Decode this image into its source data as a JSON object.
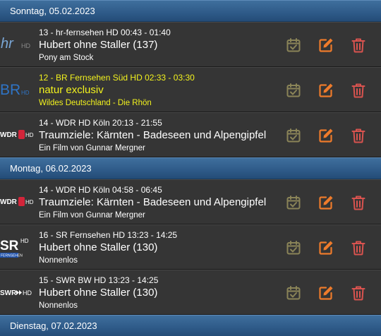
{
  "colors": {
    "timer": "#8a8458",
    "edit": "#ee7b2b",
    "delete": "#d9534f",
    "active_text": "#f2f21e",
    "header": "#2e5a88"
  },
  "days": [
    {
      "date": "Sonntag, 05.02.2023",
      "entries": [
        {
          "channel_line": "13 - hr-fernsehen HD  00:43 - 01:40",
          "title": "Hubert ohne Staller (137)",
          "subtitle": "Pony am Stock",
          "logo": "hr-hd-logo",
          "logo_text": "hr",
          "logo_suffix": "HD",
          "active": false
        },
        {
          "channel_line": "12 - BR Fernsehen Süd HD  02:33 - 03:30",
          "title": "natur exclusiv",
          "subtitle": "Wildes Deutschland - Die Rhön",
          "logo": "br-hd-logo",
          "logo_text": "BR",
          "logo_suffix": "HD",
          "active": true
        },
        {
          "channel_line": "14 - WDR HD Köln  20:13 - 21:55",
          "title": "Traumziele: Kärnten - Badeseen und Alpengipfel",
          "subtitle": "Ein Film von Gunnar Mergner",
          "logo": "wdr-hd-logo",
          "logo_text": "WDR",
          "logo_suffix": "HD",
          "active": false
        }
      ]
    },
    {
      "date": "Montag, 06.02.2023",
      "entries": [
        {
          "channel_line": "14 - WDR HD Köln  04:58 - 06:45",
          "title": "Traumziele: Kärnten - Badeseen und Alpengipfel",
          "subtitle": "Ein Film von Gunnar Mergner",
          "logo": "wdr-hd-logo",
          "logo_text": "WDR",
          "logo_suffix": "HD",
          "active": false
        },
        {
          "channel_line": "16 - SR Fernsehen HD  13:23 - 14:25",
          "title": "Hubert ohne Staller (130)",
          "subtitle": "Nonnenlos",
          "logo": "sr-hd-logo",
          "logo_text": "SR",
          "logo_suffix": "HD",
          "logo_sub": "FERNSEHEN",
          "active": false
        },
        {
          "channel_line": "15 - SWR BW HD  13:23 - 14:25",
          "title": "Hubert ohne Staller (130)",
          "subtitle": "Nonnenlos",
          "logo": "swr-hd-logo",
          "logo_text": "SWR",
          "logo_suffix": "HD",
          "active": false
        }
      ]
    },
    {
      "date": "Dienstag, 07.02.2023",
      "entries": []
    }
  ]
}
